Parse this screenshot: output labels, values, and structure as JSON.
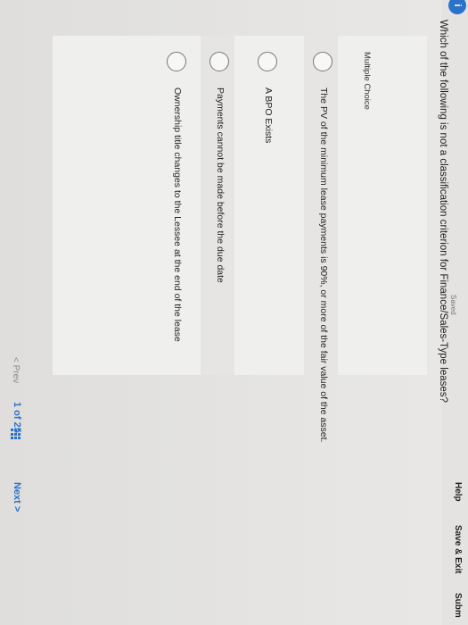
{
  "header": {
    "saved_status": "Saved",
    "help_label": "Help",
    "save_exit_label": "Save & Exit",
    "submit_label": "Subm"
  },
  "question": {
    "text": "Which of the following is not a classification criterion for Finance/Sales-Type leases?",
    "type_label": "Multiple Choice",
    "choices": [
      {
        "label": "The PV of the minimum lease payments is 90%, or more of the fair value of the asset."
      },
      {
        "label": "A BPO Exists"
      },
      {
        "label": "Payments cannot be made before the due date"
      },
      {
        "label": "Ownership title changes to the Lessee at the end of the lease"
      }
    ]
  },
  "footer": {
    "prev_label": "< Prev",
    "page_indicator": "1 of 25",
    "next_label": "Next >"
  },
  "colors": {
    "accent": "#2d72c9",
    "background": "#e4e3e1"
  }
}
